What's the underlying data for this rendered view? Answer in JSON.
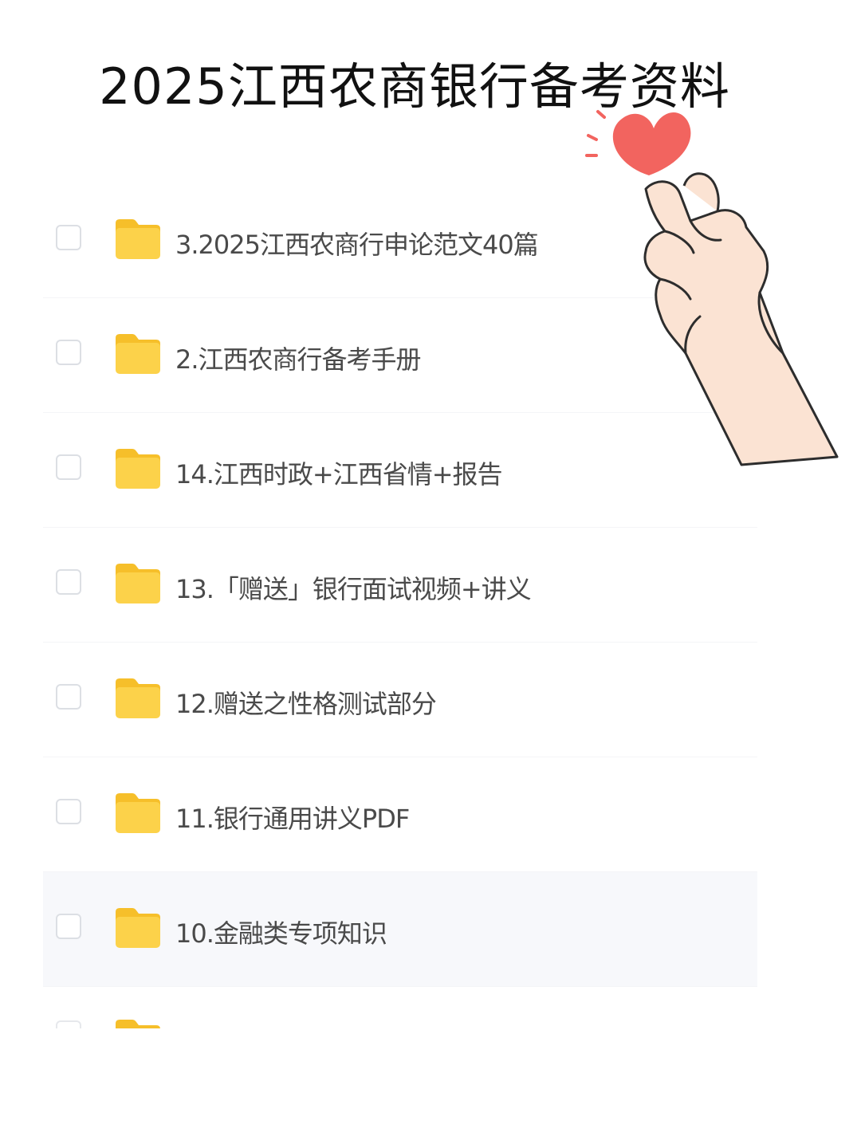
{
  "title": "2025江西农商银行备考资料",
  "files": [
    {
      "name": "3.2025江西农商行申论范文40篇",
      "type": "folder"
    },
    {
      "name": "2.江西农商行备考手册",
      "type": "folder"
    },
    {
      "name": "14.江西时政+江西省情+报告",
      "type": "folder"
    },
    {
      "name": "13.「赠送」银行面试视频+讲义",
      "type": "folder"
    },
    {
      "name": "12.赠送之性格测试部分",
      "type": "folder"
    },
    {
      "name": "11.银行通用讲义PDF",
      "type": "folder"
    },
    {
      "name": "10.金融类专项知识",
      "type": "folder"
    }
  ],
  "colors": {
    "folder_main": "#fcd24a",
    "folder_tab": "#f6bf2a",
    "heart": "#f2645f",
    "skin": "#fbe3d3",
    "outline": "#2d2d2d"
  },
  "icons": {
    "folder": "folder-icon",
    "checkbox": "checkbox",
    "sticker": "finger-heart-sticker"
  }
}
